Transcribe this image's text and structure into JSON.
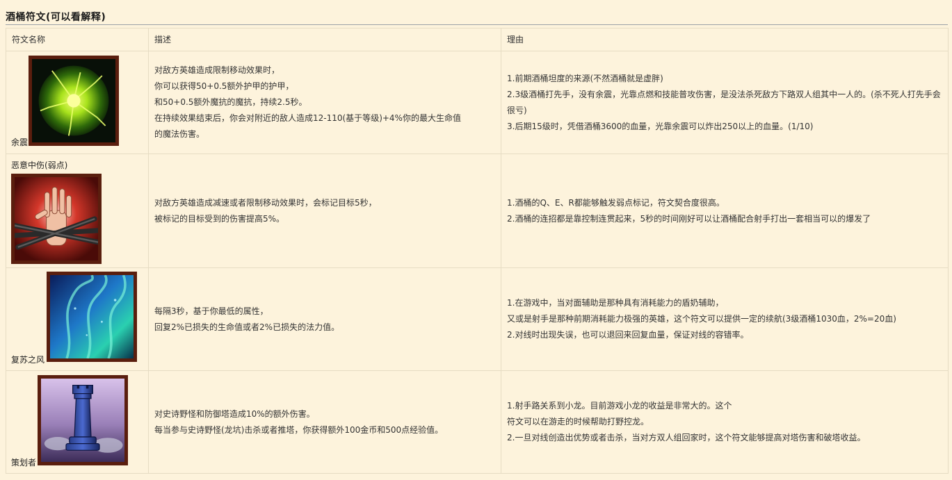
{
  "section_title": "酒桶符文(可以看解释)",
  "table": {
    "headers": [
      "符文名称",
      "描述",
      "理由"
    ],
    "rows": [
      {
        "name": "余震",
        "icon": "aftershock-icon",
        "description": [
          "对敌方英雄造成限制移动效果时，",
          "你可以获得50+0.5额外护甲的护甲，",
          "和50+0.5额外魔抗的魔抗，持续2.5秒。",
          "在持续效果结束后，你会对附近的敌人造成12-110(基于等级)+4%你的最大生命值",
          "的魔法伤害。"
        ],
        "reason": [
          "1.前期酒桶坦度的来源(不然酒桶就是虚胖)",
          "2.3级酒桶打先手，没有余震，光靠点燃和技能普攻伤害，是没法杀死敌方下路双人组其中一人的。(杀不死人打先手会很亏)",
          "3.后期15级时，凭借酒桶3600的血量，光靠余震可以炸出250以上的血量。(1/10)"
        ]
      },
      {
        "name": "恶意中伤(弱点)",
        "icon": "cheap-shot-hand-icon",
        "description": [
          "对敌方英雄造成减速或者限制移动效果时，会标记目标5秒，",
          "被标记的目标受到的伤害提高5%。"
        ],
        "reason": [
          "1.酒桶的Q、E、R都能够触发弱点标记，符文契合度很高。",
          "2.酒桶的连招都是靠控制连贯起来，5秒的时间刚好可以让酒桶配合射手打出一套相当可以的爆发了"
        ]
      },
      {
        "name": "复苏之风",
        "icon": "revitalize-wind-icon",
        "description": [
          "每隔3秒，基于你最低的属性，",
          "回复2%已损失的生命值或者2%已损失的法力值。"
        ],
        "reason": [
          "1.在游戏中，当对面辅助是那种具有消耗能力的盾奶辅助，",
          "又或是射手是那种前期消耗能力极强的英雄，这个符文可以提供一定的续航(3级酒桶1030血，2%=20血)",
          "2.对线时出现失误，也可以退回来回复血量，保证对线的容错率。"
        ]
      },
      {
        "name": "策划者",
        "icon": "chess-rook-icon",
        "description": [
          "对史诗野怪和防御塔造成10%的额外伤害。",
          "每当参与史诗野怪(龙坑)击杀或者推塔，你获得额外100金币和500点经验值。"
        ],
        "reason": [
          "1.射手路关系到小龙。目前游戏小龙的收益是非常大的。这个",
          "符文可以在游走的时候帮助打野控龙。",
          "2.一旦对线创造出优势或者击杀，当对方双人组回家时，这个符文能够提高对塔伤害和破塔收益。"
        ]
      }
    ]
  }
}
